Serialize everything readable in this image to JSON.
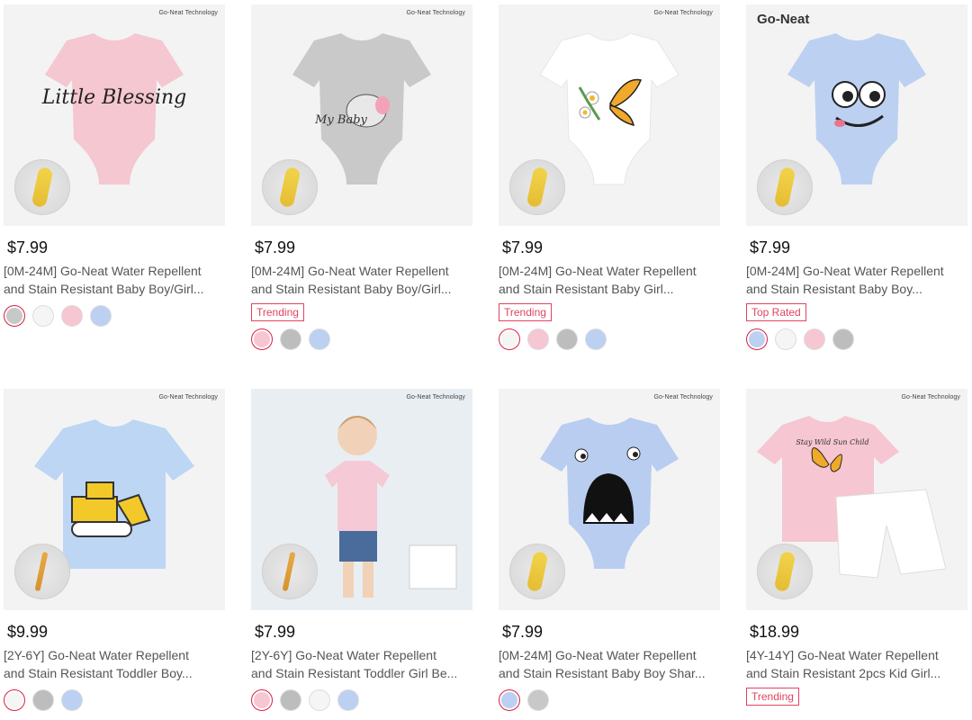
{
  "brand": {
    "tag": "Go-Neat Technology",
    "logo": "Go-Neat"
  },
  "products": [
    {
      "price": "$7.99",
      "title_line1": "[0M-24M] Go-Neat Water Repellent",
      "title_line2": "and Stain Resistant Baby Boy/Girl...",
      "badge": "",
      "garment_color": "#f5c7d0",
      "print_text": "Little Blessing",
      "swatches": [
        "#c8c8c8",
        "#f5f5f5",
        "#f6c6d2",
        "#bcd0f2"
      ],
      "selected_swatch": 0
    },
    {
      "price": "$7.99",
      "title_line1": "[0M-24M] Go-Neat Water Repellent",
      "title_line2": "and Stain Resistant Baby Boy/Girl...",
      "badge": "Trending",
      "garment_color": "#c9c9c9",
      "print_text": "My Baby",
      "swatches": [
        "#f6c6d2",
        "#bdbdbd",
        "#bcd0f2"
      ],
      "selected_swatch": 0
    },
    {
      "price": "$7.99",
      "title_line1": "[0M-24M] Go-Neat Water Repellent",
      "title_line2": "and Stain Resistant Baby Girl...",
      "badge": "Trending",
      "garment_color": "#ffffff",
      "print_text": "",
      "swatches": [
        "#f5f5f5",
        "#f6c6d2",
        "#bdbdbd",
        "#bcd0f2"
      ],
      "selected_swatch": 0
    },
    {
      "price": "$7.99",
      "title_line1": "[0M-24M] Go-Neat Water Repellent",
      "title_line2": "and Stain Resistant Baby Boy...",
      "badge": "Top Rated",
      "garment_color": "#bcd0f2",
      "print_text": "",
      "swatches": [
        "#bcd0f2",
        "#f5f5f5",
        "#f6c6d2",
        "#bdbdbd"
      ],
      "selected_swatch": 0
    },
    {
      "price": "$9.99",
      "title_line1": "[2Y-6Y] Go-Neat Water Repellent",
      "title_line2": "and Stain Resistant Toddler Boy...",
      "badge": "",
      "garment_color": "#bcd6f4",
      "print_text": "",
      "swatches": [
        "#f5f5f5",
        "#bdbdbd",
        "#bcd0f2"
      ],
      "selected_swatch": 0
    },
    {
      "price": "$7.99",
      "title_line1": "[2Y-6Y] Go-Neat Water Repellent",
      "title_line2": "and Stain Resistant Toddler Girl Be...",
      "badge": "",
      "garment_color": "#f6c9d6",
      "print_text": "",
      "swatches": [
        "#f6c6d2",
        "#bdbdbd",
        "#f5f5f5",
        "#bcd0f2"
      ],
      "selected_swatch": 0
    },
    {
      "price": "$7.99",
      "title_line1": "[0M-24M] Go-Neat Water Repellent",
      "title_line2": "and Stain Resistant Baby Boy Shar...",
      "badge": "",
      "garment_color": "#b9cdf1",
      "print_text": "",
      "swatches": [
        "#bcd0f2",
        "#c8c8c8"
      ],
      "selected_swatch": 0
    },
    {
      "price": "$18.99",
      "title_line1": "[4Y-14Y] Go-Neat Water Repellent",
      "title_line2": "and Stain Resistant 2pcs Kid Girl...",
      "badge": "Trending",
      "garment_color": "#f6c6d2",
      "print_text": "Stay Wild Sun Child",
      "swatches": [],
      "selected_swatch": -1
    }
  ]
}
